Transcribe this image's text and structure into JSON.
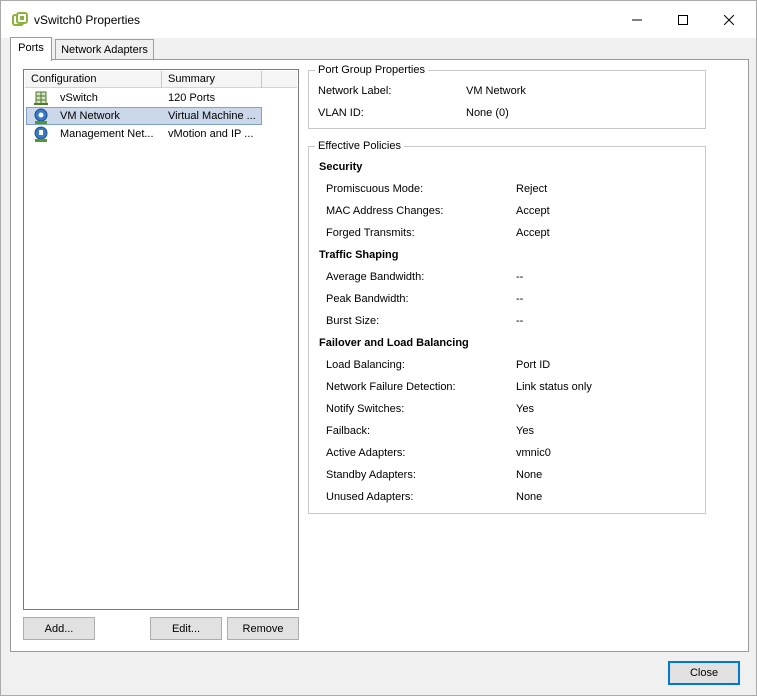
{
  "window": {
    "title": "vSwitch0 Properties",
    "icon": "vsphere-app-icon"
  },
  "tabs": [
    {
      "label": "Ports",
      "active": true
    },
    {
      "label": "Network Adapters",
      "active": false
    }
  ],
  "list": {
    "columns": [
      "Configuration",
      "Summary"
    ],
    "rows": [
      {
        "icon": "vswitch-icon",
        "configuration": "vSwitch",
        "summary": "120 Ports",
        "selected": false
      },
      {
        "icon": "vm-network-icon",
        "configuration": "VM Network",
        "summary": "Virtual Machine ...",
        "selected": true
      },
      {
        "icon": "vmkernel-icon",
        "configuration": "Management Net...",
        "summary": "vMotion and IP ...",
        "selected": false
      }
    ]
  },
  "buttons": {
    "add": "Add...",
    "edit": "Edit...",
    "remove": "Remove",
    "close": "Close"
  },
  "port_group_properties": {
    "legend": "Port Group Properties",
    "rows": [
      {
        "label": "Network Label:",
        "value": "VM Network"
      },
      {
        "label": "VLAN ID:",
        "value": "None (0)"
      }
    ]
  },
  "effective_policies": {
    "legend": "Effective Policies",
    "sections": [
      {
        "title": "Security",
        "rows": [
          {
            "label": "Promiscuous Mode:",
            "value": "Reject"
          },
          {
            "label": "MAC Address Changes:",
            "value": "Accept"
          },
          {
            "label": "Forged Transmits:",
            "value": "Accept"
          }
        ]
      },
      {
        "title": "Traffic Shaping",
        "rows": [
          {
            "label": "Average Bandwidth:",
            "value": "--"
          },
          {
            "label": "Peak Bandwidth:",
            "value": "--"
          },
          {
            "label": "Burst Size:",
            "value": "--"
          }
        ]
      },
      {
        "title": "Failover and Load Balancing",
        "rows": [
          {
            "label": "Load Balancing:",
            "value": "Port ID"
          },
          {
            "label": "Network Failure Detection:",
            "value": "Link status only"
          },
          {
            "label": "Notify Switches:",
            "value": "Yes"
          },
          {
            "label": "Failback:",
            "value": "Yes"
          },
          {
            "label": "Active Adapters:",
            "value": "vmnic0"
          },
          {
            "label": "Standby Adapters:",
            "value": "None"
          },
          {
            "label": "Unused Adapters:",
            "value": "None"
          }
        ]
      }
    ]
  },
  "colors": {
    "selection_bg": "#cbd8ea",
    "selection_border": "#7da2ce",
    "default_button_border": "#0078d7"
  }
}
